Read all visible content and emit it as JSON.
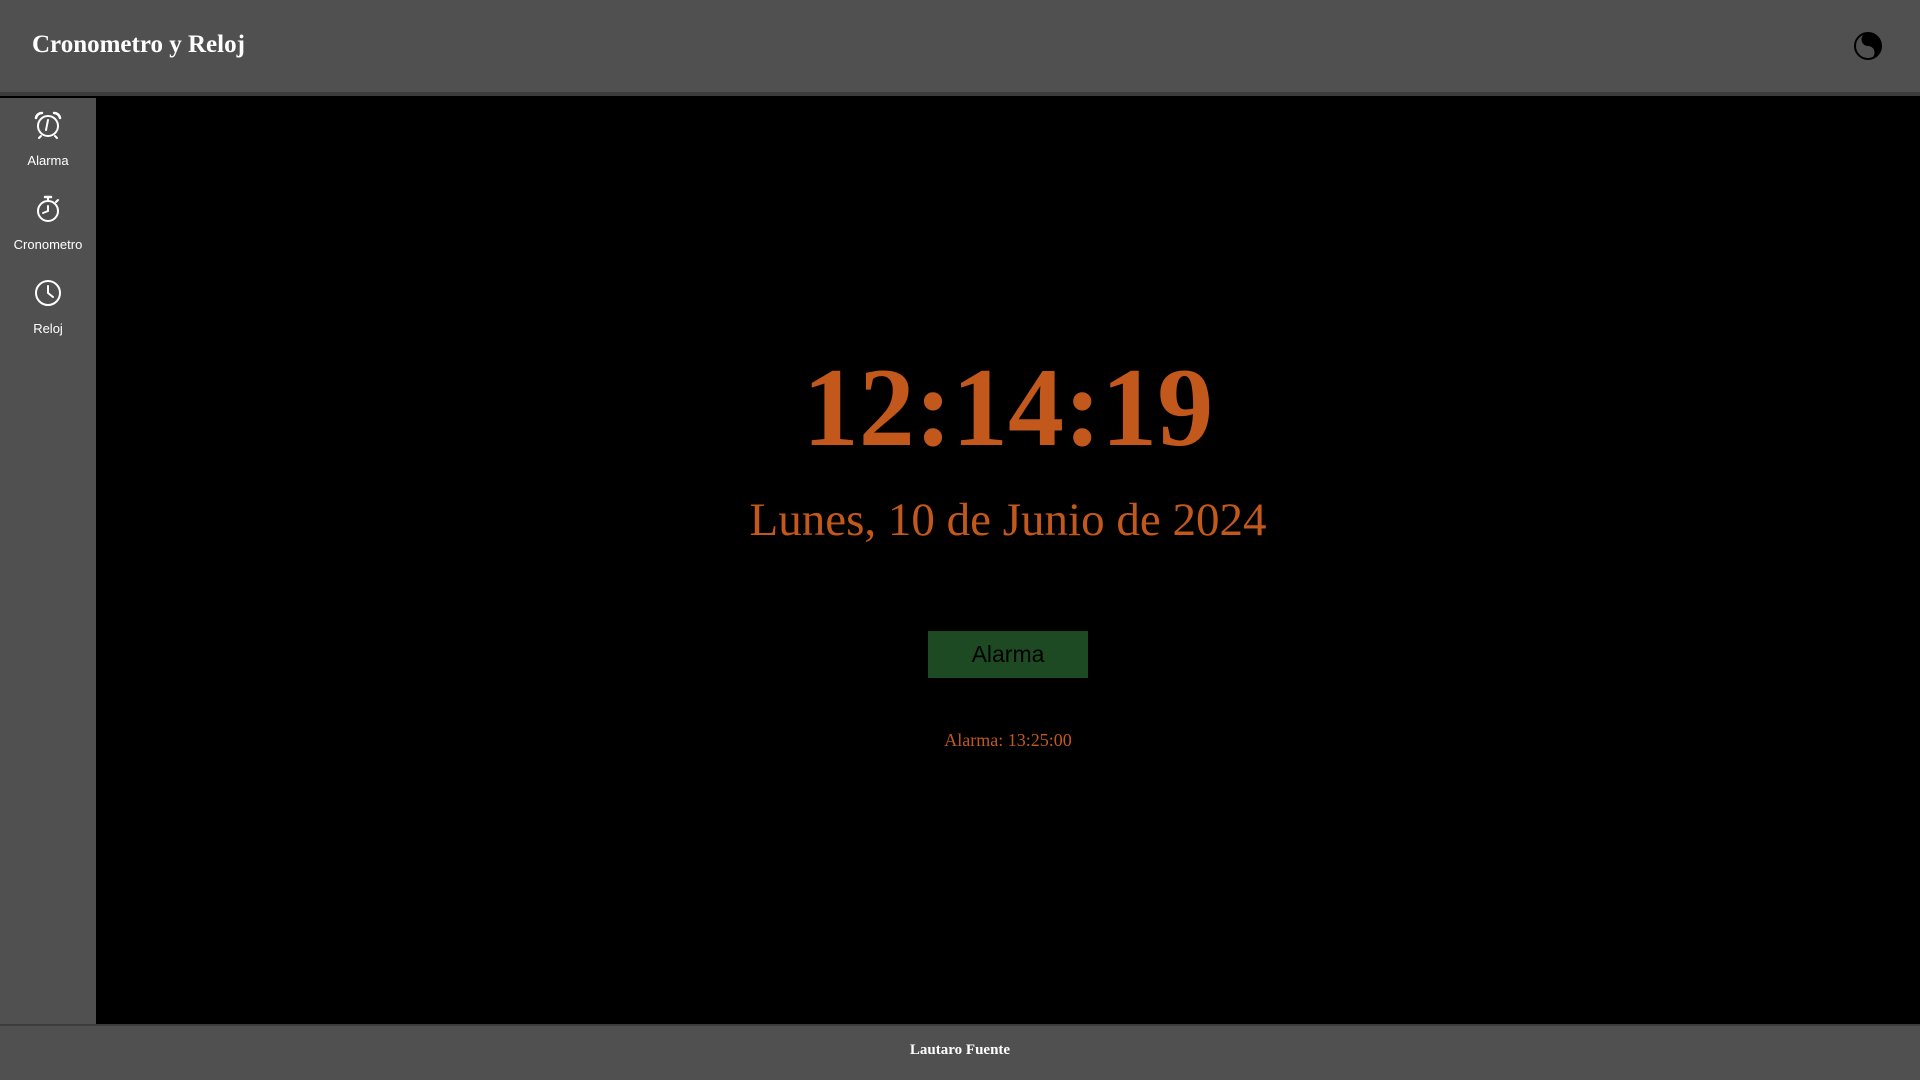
{
  "header": {
    "title": "Cronometro y Reloj",
    "theme_toggle_icon": "contrast-toggle-icon"
  },
  "sidebar": {
    "items": [
      {
        "label": "Alarma",
        "icon": "alarm-clock-icon"
      },
      {
        "label": "Cronometro",
        "icon": "stopwatch-icon"
      },
      {
        "label": "Reloj",
        "icon": "clock-icon"
      }
    ]
  },
  "main": {
    "time": "12:14:19",
    "date": "Lunes, 10 de Junio de 2024",
    "alarm_button_label": "Alarma",
    "alarm_status": "Alarma: 13:25:00"
  },
  "footer": {
    "author": "Lautaro Fuente"
  },
  "colors": {
    "accent": "#c2581c",
    "panel": "#505050",
    "background": "#000000",
    "button": "#1d4a22"
  }
}
